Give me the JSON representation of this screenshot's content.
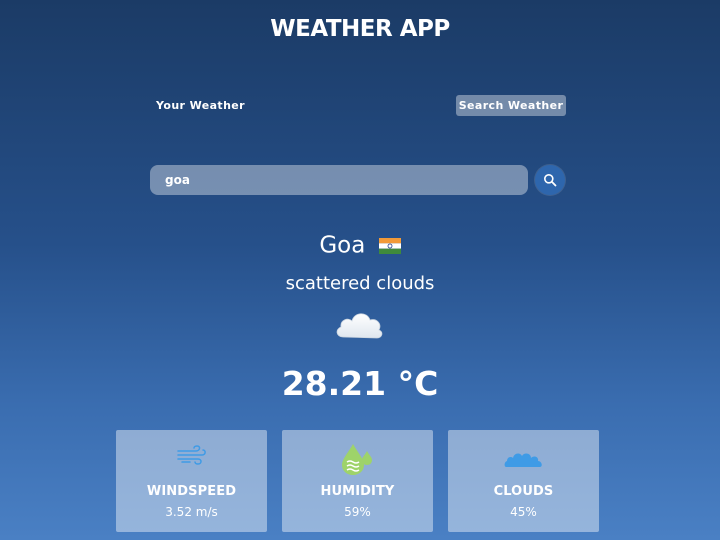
{
  "app": {
    "title": "WEATHER APP"
  },
  "tabs": {
    "your_weather": "Your Weather",
    "search_weather": "Search Weather"
  },
  "search": {
    "value": "goa"
  },
  "weather": {
    "city": "Goa",
    "description": "scattered clouds",
    "temperature": "28.21 °C",
    "icon": "cloud-icon"
  },
  "stats": [
    {
      "label": "WINDSPEED",
      "value": "3.52 m/s",
      "icon": "wind-icon"
    },
    {
      "label": "HUMIDITY",
      "value": "59%",
      "icon": "humidity-icon"
    },
    {
      "label": "CLOUDS",
      "value": "45%",
      "icon": "clouds-icon"
    }
  ],
  "colors": {
    "accent": "#2e66ad",
    "icon_green": "#9ed36a",
    "icon_blue": "#3f9be6"
  }
}
